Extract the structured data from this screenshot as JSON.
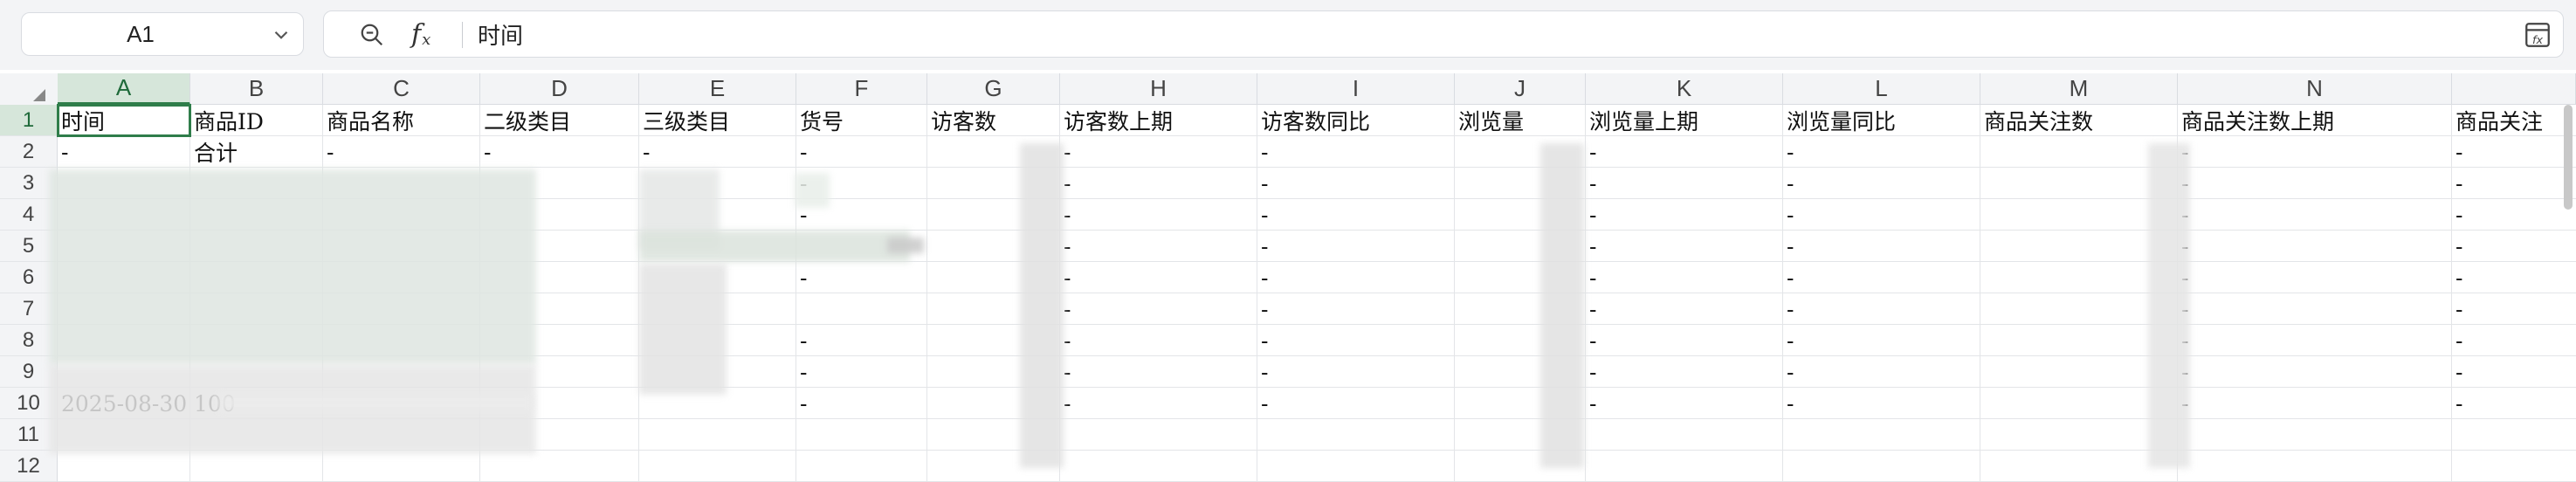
{
  "name_box": {
    "value": "A1"
  },
  "formula_bar": {
    "content": "时间"
  },
  "columns": [
    "A",
    "B",
    "C",
    "D",
    "E",
    "F",
    "G",
    "H",
    "I",
    "J",
    "K",
    "L",
    "M",
    "N"
  ],
  "rows": [
    "1",
    "2",
    "3",
    "4",
    "5",
    "6",
    "7",
    "8",
    "9",
    "10",
    "11",
    "12"
  ],
  "header_row": [
    "时间",
    "商品ID",
    "商品名称",
    "二级类目",
    "三级类目",
    "货号",
    "访客数",
    "访客数上期",
    "访客数同比",
    "浏览量",
    "浏览量上期",
    "浏览量同比",
    "商品关注数",
    "商品关注数上期",
    "商品关注"
  ],
  "row2": [
    "-",
    "合计",
    "-",
    "-",
    "-",
    "-",
    "",
    "-",
    "-",
    "",
    "-",
    "-",
    "",
    "-",
    "-"
  ],
  "dash": "-",
  "row10_date": "2025-08-30",
  "row10_id_prefix": "100",
  "icons": {
    "name_dropdown": "chevron-down-icon",
    "zoom": "zoom-icon",
    "function": "fx-icon",
    "expand": "expand-formula-icon",
    "select_all": "select-all-triangle-icon"
  },
  "colors": {
    "accent": "#2f7d4a",
    "header_bg": "#f3f4f6",
    "grid": "#e3e5e8"
  }
}
